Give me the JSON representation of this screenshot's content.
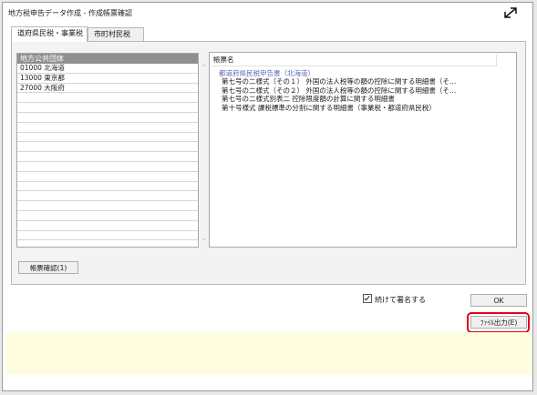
{
  "window": {
    "title": "地方税申告データ作成 - 作成帳票確認"
  },
  "tabs": [
    {
      "label": "道府県民税・事業税",
      "active": true
    },
    {
      "label": "市町村民税",
      "active": false
    }
  ],
  "municipality_list": {
    "header": "地方公共団体",
    "rows": [
      {
        "code": "01000",
        "name": "北海道"
      },
      {
        "code": "13000",
        "name": "東京都"
      },
      {
        "code": "27000",
        "name": "大阪府"
      }
    ]
  },
  "documents": {
    "header": "帳票名",
    "group": "都道府県民税申告書（北海道）",
    "items": [
      "第七号の二様式（その１） 外国の法人税等の額の控除に関する明細書（そ…",
      "第七号の二様式（その２） 外国の法人税等の額の控除に関する明細書（そ…",
      "第七号の二様式別表二 控除限度額の計算に関する明細書",
      "第十号様式 課税標準の分割に関する明細書（事業税・都道府県民税）"
    ]
  },
  "buttons": {
    "confirm": "帳票確認(1)",
    "ok": "OK",
    "file_output": "ﾌｧｲﾙ出力(E)"
  },
  "checkbox": {
    "label": "続けて署名する",
    "checked": true
  },
  "colors": {
    "highlight": "#e0001a",
    "info_bar": "#fffde0",
    "group_text": "#5a67b5"
  }
}
